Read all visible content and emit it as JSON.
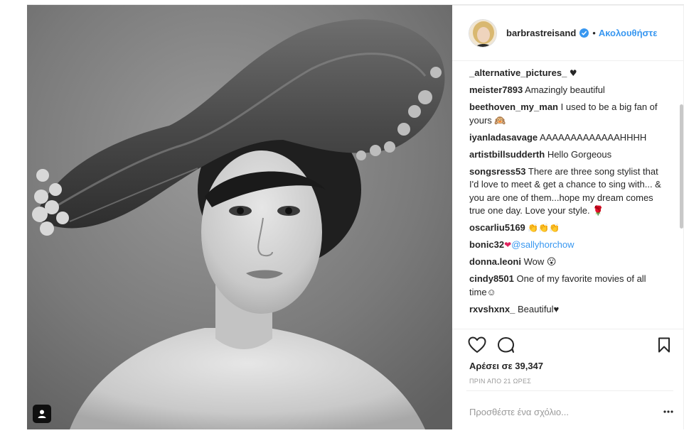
{
  "post": {
    "author": "barbrastreisand",
    "verified": true,
    "separator": "•",
    "follow_label": "Ακολουθήστε",
    "likes": "Αρέσει σε 39,347",
    "time": "ΠΡΙΝ ΑΠΟ 21 ΩΡΕΣ"
  },
  "comments": [
    {
      "user": "_alternative_pictures_",
      "text": "♥"
    },
    {
      "user": "meister7893",
      "text": "Amazingly beautiful"
    },
    {
      "user": "beethoven_my_man",
      "text": "I used to be a big fan of yours 🙉"
    },
    {
      "user": "iyanladasavage",
      "text": "AAAAAAAAAAAAAHHHH"
    },
    {
      "user": "artistbillsudderth",
      "text": "Hello Gorgeous"
    },
    {
      "user": "songsress53",
      "text": "There are three song stylist that I'd love to meet & get a chance to sing with... & you are one of them...hope my dream comes true one day. Love your style. 🌹"
    },
    {
      "user": "oscarliu5169",
      "text": "👏👏👏"
    },
    {
      "user": "bonic32",
      "text": "❤",
      "mention": "@sallyhorchow"
    },
    {
      "user": "donna.leoni",
      "text": "Wow 😮"
    },
    {
      "user": "cindy8501",
      "text": "One of my favorite movies of all time☺"
    },
    {
      "user": "rxvshxnx_",
      "text": "Beautiful♥"
    }
  ],
  "add_comment": {
    "placeholder": "Προσθέστε ένα σχόλιο..."
  },
  "icons": {
    "like": "heart-icon",
    "comment": "comment-bubble-icon",
    "save": "bookmark-icon",
    "more": "more-options-icon",
    "tag": "user-tag-icon",
    "verified": "verified-badge-icon"
  },
  "colors": {
    "link_blue": "#3897f0",
    "text": "#262626",
    "muted": "#999999",
    "border": "#efefef"
  }
}
